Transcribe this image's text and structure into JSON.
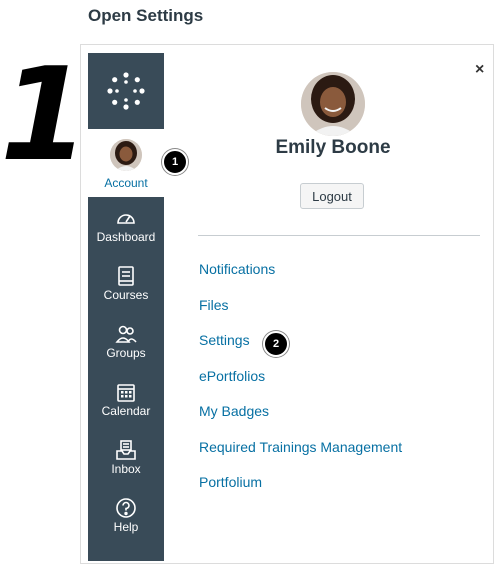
{
  "heading": "Open Settings",
  "step_numbers": {
    "big": "1",
    "account": "1",
    "settings": "2"
  },
  "close_label": "×",
  "nav": {
    "account_label": "Account",
    "items": [
      {
        "label": "Dashboard",
        "icon": "dashboard-icon"
      },
      {
        "label": "Courses",
        "icon": "courses-icon"
      },
      {
        "label": "Groups",
        "icon": "groups-icon"
      },
      {
        "label": "Calendar",
        "icon": "calendar-icon"
      },
      {
        "label": "Inbox",
        "icon": "inbox-icon"
      },
      {
        "label": "Help",
        "icon": "help-icon"
      }
    ]
  },
  "profile": {
    "name": "Emily Boone",
    "logout_label": "Logout"
  },
  "links": [
    "Notifications",
    "Files",
    "Settings",
    "ePortfolios",
    "My Badges",
    "Required Trainings Management",
    "Portfolium"
  ],
  "colors": {
    "nav_bg": "#394b58",
    "link": "#0770a3",
    "text": "#2d3b45"
  }
}
